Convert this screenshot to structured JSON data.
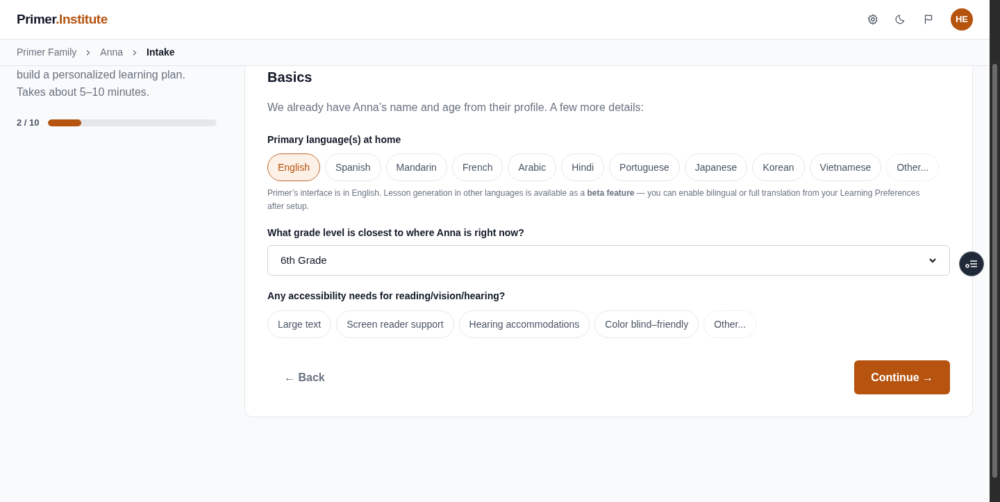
{
  "brand": {
    "primary": "Primer",
    "accent": ".Institute"
  },
  "header_actions": [
    {
      "kind": "settings"
    },
    {
      "kind": "theme"
    },
    {
      "kind": "flag"
    }
  ],
  "avatar": {
    "initials": "HE"
  },
  "breadcrumbs": [
    {
      "label": "Primer Family",
      "current": false
    },
    {
      "label": "Anna",
      "current": false
    },
    {
      "label": "Intake",
      "current": true
    }
  ],
  "sidebar": {
    "intro_lines": [
      "build a personalized learning plan.",
      "Takes about 5–10 minutes."
    ],
    "progress": {
      "reading": "2 / 10",
      "level": 0.2
    }
  },
  "section": {
    "title": "Basics",
    "intro": "We already have Anna’s name and age from their profile. A few more details:"
  },
  "languages": {
    "label": "Primary language(s) at home",
    "options": [
      {
        "label": "English",
        "selected": true,
        "kind": "option"
      },
      {
        "label": "Spanish",
        "selected": false,
        "kind": "option"
      },
      {
        "label": "Mandarin",
        "selected": false,
        "kind": "option"
      },
      {
        "label": "French",
        "selected": false,
        "kind": "option"
      },
      {
        "label": "Arabic",
        "selected": false,
        "kind": "option"
      },
      {
        "label": "Hindi",
        "selected": false,
        "kind": "option"
      },
      {
        "label": "Portuguese",
        "selected": false,
        "kind": "option"
      },
      {
        "label": "Japanese",
        "selected": false,
        "kind": "option"
      },
      {
        "label": "Korean",
        "selected": false,
        "kind": "option"
      },
      {
        "label": "Vietnamese",
        "selected": false,
        "kind": "option"
      },
      {
        "label": "Other...",
        "selected": false,
        "kind": "other"
      }
    ],
    "note": "Primer’s interface is in English. Lesson generation in other languages is available as a **beta feature** — you can enable bilingual or full translation from your Learning Preferences after setup."
  },
  "grade": {
    "label": "What grade level is closest to where Anna is right now?",
    "value": "6th Grade"
  },
  "accessibility": {
    "label": "Any accessibility needs for reading/vision/hearing?",
    "options": [
      {
        "label": "Large text",
        "selected": false,
        "kind": "option"
      },
      {
        "label": "Screen reader support",
        "selected": false,
        "kind": "option"
      },
      {
        "label": "Hearing accommodations",
        "selected": false,
        "kind": "option"
      },
      {
        "label": "Color blind–friendly",
        "selected": false,
        "kind": "option"
      },
      {
        "label": "Other...",
        "selected": false,
        "kind": "other"
      }
    ]
  },
  "buttons": {
    "back": "← Back",
    "continue": "Continue →"
  }
}
